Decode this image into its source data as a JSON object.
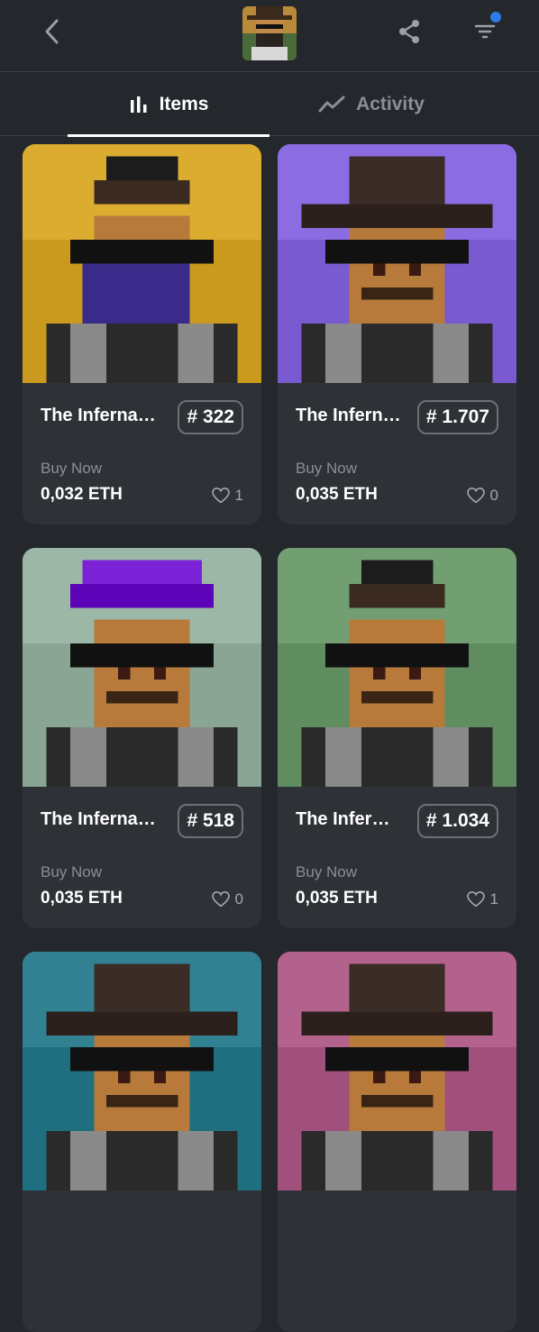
{
  "header": {
    "back_icon": "chevron-left-icon",
    "share_icon": "share-icon",
    "filter_icon": "filter-icon",
    "filter_dot_color": "#2f7be8"
  },
  "tabs": [
    {
      "label": "Items",
      "icon": "bar-chart-icon",
      "active": true
    },
    {
      "label": "Activity",
      "icon": "trend-line-icon",
      "active": false
    }
  ],
  "items": [
    {
      "title": "The Inferna…",
      "number": "# 322",
      "status": "Buy Now",
      "price": "0,032 ETH",
      "likes": "1",
      "bg": "#c99a1d",
      "hat": "cap",
      "hair_color": ""
    },
    {
      "title": "The Infern…",
      "number": "# 1.707",
      "status": "Buy Now",
      "price": "0,035 ETH",
      "likes": "0",
      "bg": "#7a5ad0",
      "hat": "fedora",
      "hair_color": ""
    },
    {
      "title": "The Inferna…",
      "number": "# 518",
      "status": "Buy Now",
      "price": "0,035 ETH",
      "likes": "0",
      "bg": "#8aa593",
      "hat": "hair",
      "hair_color": "#7b22d6"
    },
    {
      "title": "The Infer…",
      "number": "# 1.034",
      "status": "Buy Now",
      "price": "0,035 ETH",
      "likes": "1",
      "bg": "#5f8d5f",
      "hat": "cap",
      "hair_color": ""
    },
    {
      "title": "",
      "number": "",
      "status": "",
      "price": "",
      "likes": "",
      "bg": "#1f6f80",
      "hat": "fedora",
      "hair_color": ""
    },
    {
      "title": "",
      "number": "",
      "status": "",
      "price": "",
      "likes": "",
      "bg": "#a0507a",
      "hat": "fedora",
      "hair_color": ""
    }
  ]
}
